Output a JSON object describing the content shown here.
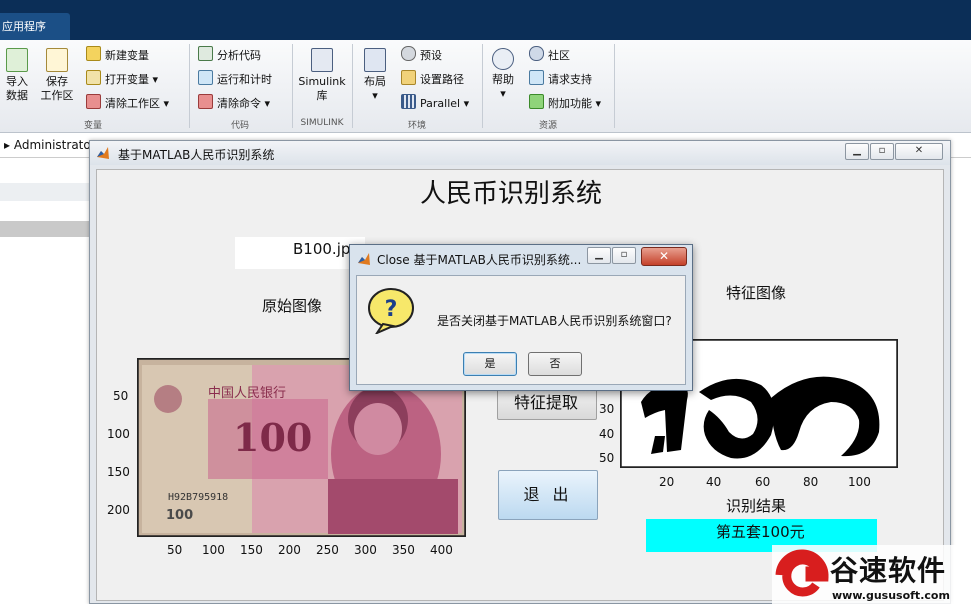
{
  "app_tab": {
    "label": "应用程序"
  },
  "ribbon": {
    "groups": {
      "variable": "变量",
      "code": "代码",
      "simulink": "SIMULINK",
      "environment": "环境",
      "resources": "资源"
    },
    "import": {
      "line1": "导入",
      "line2": "数据"
    },
    "save": {
      "line1": "保存",
      "line2": "工作区"
    },
    "new_var": "新建变量",
    "open_var": "打开变量 ▾",
    "clear_ws": "清除工作区 ▾",
    "analyze_code": "分析代码",
    "run_time": "运行和计时",
    "clear_cmd": "清除命令 ▾",
    "simulink": {
      "line1": "Simulink",
      "line2": "库"
    },
    "layout": {
      "line1": "布局",
      "line2": "▾"
    },
    "prefs": "预设",
    "set_path": "设置路径",
    "parallel": "Parallel ▾",
    "help": {
      "line1": "帮助",
      "line2": "▾"
    },
    "community": "社区",
    "support": "请求支持",
    "addons": "附加功能 ▾"
  },
  "address": {
    "text": "Administrato"
  },
  "figure": {
    "title": "基于MATLAB人民币识别系统",
    "main_title": "人民币识别系统",
    "file_name": "B100.jpg",
    "label_original": "原始图像",
    "label_feature": "特征图像",
    "btn_feature": "特征提取",
    "btn_exit": "退 出",
    "label_result": "识别结果",
    "result_text": "第五套100元",
    "axes1": {
      "y_ticks": [
        "50",
        "100",
        "150",
        "200"
      ],
      "x_ticks": [
        "50",
        "100",
        "150",
        "200",
        "250",
        "300",
        "350",
        "400"
      ]
    },
    "axes2": {
      "y_ticks": [
        "30",
        "40",
        "50"
      ],
      "x_ticks": [
        "20",
        "40",
        "60",
        "80",
        "100"
      ]
    },
    "banknote": {
      "header": "中国人民银行",
      "denomination": "100",
      "serial": "H92B795918",
      "corner_value": "100"
    }
  },
  "dialog": {
    "title": "Close 基于MATLAB人民币识别系统...",
    "message": "是否关闭基于MATLAB人民币识别系统窗口?",
    "yes": "是",
    "no": "否"
  },
  "watermark": {
    "brand": "谷速软件",
    "url": "www.gususoft.com"
  }
}
